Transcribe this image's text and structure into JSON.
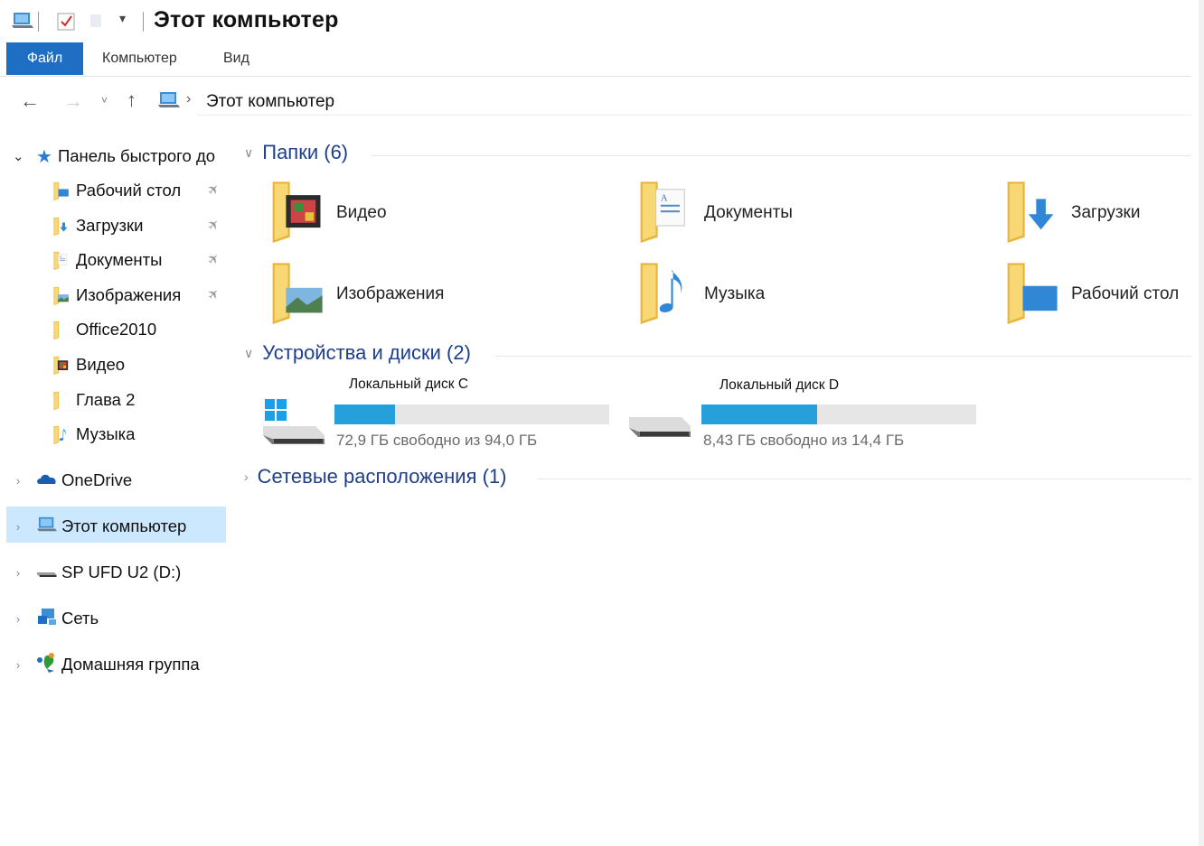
{
  "window": {
    "title": "Этот компьютер"
  },
  "ribbon": {
    "tabs": [
      "Файл",
      "Компьютер",
      "Вид"
    ]
  },
  "address": {
    "path": "Этот компьютер",
    "separator": "›"
  },
  "sidebar": {
    "quick_access": {
      "label": "Панель быстрого до",
      "items": [
        {
          "label": "Рабочий стол",
          "icon": "desktop-folder-icon",
          "pinned": true
        },
        {
          "label": "Загрузки",
          "icon": "downloads-folder-icon",
          "pinned": true
        },
        {
          "label": "Документы",
          "icon": "documents-folder-icon",
          "pinned": true
        },
        {
          "label": "Изображения",
          "icon": "pictures-folder-icon",
          "pinned": true
        },
        {
          "label": "Office2010",
          "icon": "folder-icon",
          "pinned": false
        },
        {
          "label": "Видео",
          "icon": "videos-folder-icon",
          "pinned": false
        },
        {
          "label": "Глава 2",
          "icon": "folder-icon",
          "pinned": false
        },
        {
          "label": "Музыка",
          "icon": "music-folder-icon",
          "pinned": false
        }
      ]
    },
    "roots": [
      {
        "label": "OneDrive",
        "icon": "onedrive-icon"
      },
      {
        "label": "Этот компьютер",
        "icon": "computer-icon",
        "selected": true
      },
      {
        "label": "SP UFD U2 (D:)",
        "icon": "usb-drive-icon"
      },
      {
        "label": "Сеть",
        "icon": "network-icon"
      },
      {
        "label": "Домашняя группа",
        "icon": "homegroup-icon"
      }
    ]
  },
  "main": {
    "folders_header": "Папки (6)",
    "folders": [
      {
        "label": "Видео",
        "icon": "videos-folder-icon"
      },
      {
        "label": "Документы",
        "icon": "documents-folder-icon"
      },
      {
        "label": "Загрузки",
        "icon": "downloads-folder-icon"
      },
      {
        "label": "Изображения",
        "icon": "pictures-folder-icon"
      },
      {
        "label": "Музыка",
        "icon": "music-folder-icon"
      },
      {
        "label": "Рабочий стол",
        "icon": "desktop-folder-icon"
      }
    ],
    "devices_header": "Устройства и диски (2)",
    "drives": [
      {
        "name": "Локальный диск C",
        "free": "72,9 ГБ свободно из 94,0 ГБ",
        "used_fraction": 0.22,
        "icon": "windows-drive-icon"
      },
      {
        "name": "Локальный диск D",
        "free": "8,43 ГБ свободно из 14,4 ГБ",
        "used_fraction": 0.42,
        "icon": "hard-drive-icon"
      }
    ],
    "network_header": "Сетевые расположения (1)"
  },
  "colors": {
    "accent": "#1e6fc4",
    "selection": "#cce8ff",
    "bar": "#26a0da",
    "header": "#1e3f8a"
  }
}
